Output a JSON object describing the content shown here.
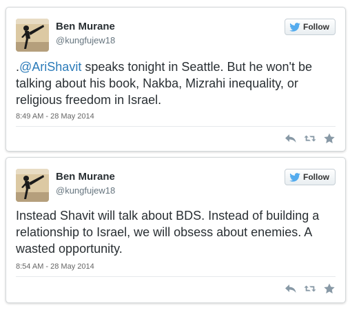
{
  "tweets": [
    {
      "author_name": "Ben Murane",
      "author_handle": "@kungfujew18",
      "follow_label": "Follow",
      "text_pre": ".",
      "mention": "@AriShavit",
      "text_post": " speaks tonight in Seattle. But he won't be talking about his book, Nakba, Mizrahi inequality, or religious freedom in Israel.",
      "timestamp": "8:49 AM - 28 May 2014"
    },
    {
      "author_name": "Ben Murane",
      "author_handle": "@kungfujew18",
      "follow_label": "Follow",
      "text": "Instead Shavit will talk about BDS. Instead of building a relationship to Israel, we will obsess about enemies. A wasted opportunity.",
      "timestamp": "8:54 AM - 28 May 2014"
    }
  ],
  "icons": [
    "avatar-image",
    "twitter-bird-icon",
    "reply-icon",
    "retweet-icon",
    "favorite-icon"
  ],
  "colors": {
    "link": "#2b7bb9",
    "text": "#292f33",
    "muted": "#66757f",
    "action_icon": "#8899a6",
    "twitter_blue": "#55acee"
  }
}
